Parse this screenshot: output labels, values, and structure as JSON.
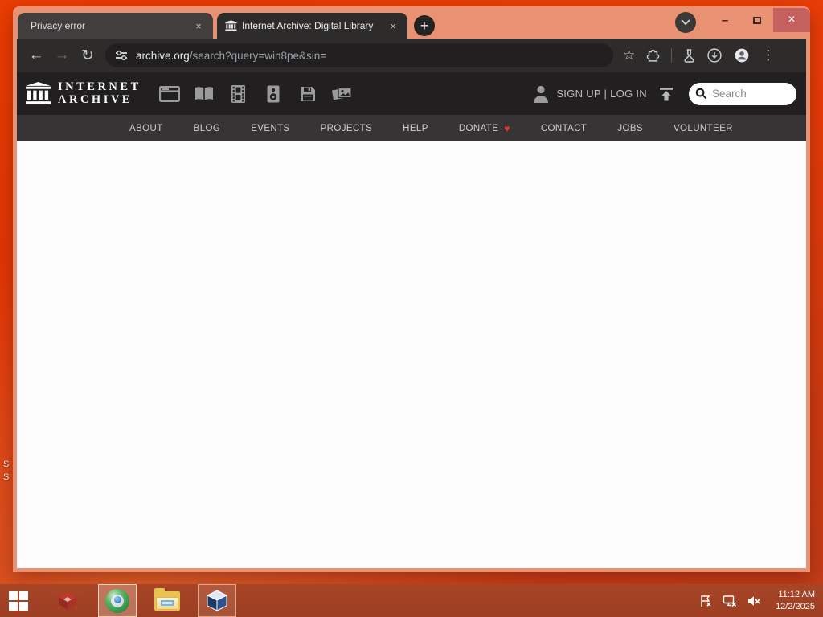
{
  "colors": {
    "titlebar": "#e99273",
    "toolbar": "#2e2c2b",
    "ia_header": "#211f20",
    "ia_nav": "#373435",
    "close_button": "#c4605e",
    "desktop_red": "#e03506",
    "taskbar_red": "#a84527",
    "heart_red": "#e23b2e"
  },
  "window": {
    "tabs": [
      {
        "title": "Privacy error"
      },
      {
        "title": "Internet Archive: Digital Library"
      }
    ],
    "icons": {
      "new_tab": "+",
      "close_tab": "×",
      "minimize": "–",
      "close_window": "×"
    }
  },
  "toolbar": {
    "icons": {
      "back": "←",
      "forward": "→",
      "reload": "↻",
      "bookmark_star": "☆",
      "menu": "⋮"
    },
    "url_domain": "archive.org",
    "url_path": "/search?query=win8pe&sin="
  },
  "ia": {
    "logo_line1": "INTERNET",
    "logo_line2": "ARCHIVE",
    "signup_login": "SIGN UP | LOG IN",
    "search_placeholder": "Search",
    "media_icons": [
      "web",
      "texts",
      "video",
      "audio",
      "software",
      "images"
    ],
    "nav": [
      {
        "label": "ABOUT"
      },
      {
        "label": "BLOG"
      },
      {
        "label": "EVENTS"
      },
      {
        "label": "PROJECTS"
      },
      {
        "label": "HELP"
      },
      {
        "label": "DONATE"
      },
      {
        "label": "CONTACT"
      },
      {
        "label": "JOBS"
      },
      {
        "label": "VOLUNTEER"
      }
    ],
    "heart": "♥"
  },
  "desktop": {
    "fragments": [
      {
        "text": "S"
      },
      {
        "text": "S"
      }
    ]
  },
  "taskbar": {
    "time": "11:12 AM",
    "date": "12/2/2025"
  }
}
